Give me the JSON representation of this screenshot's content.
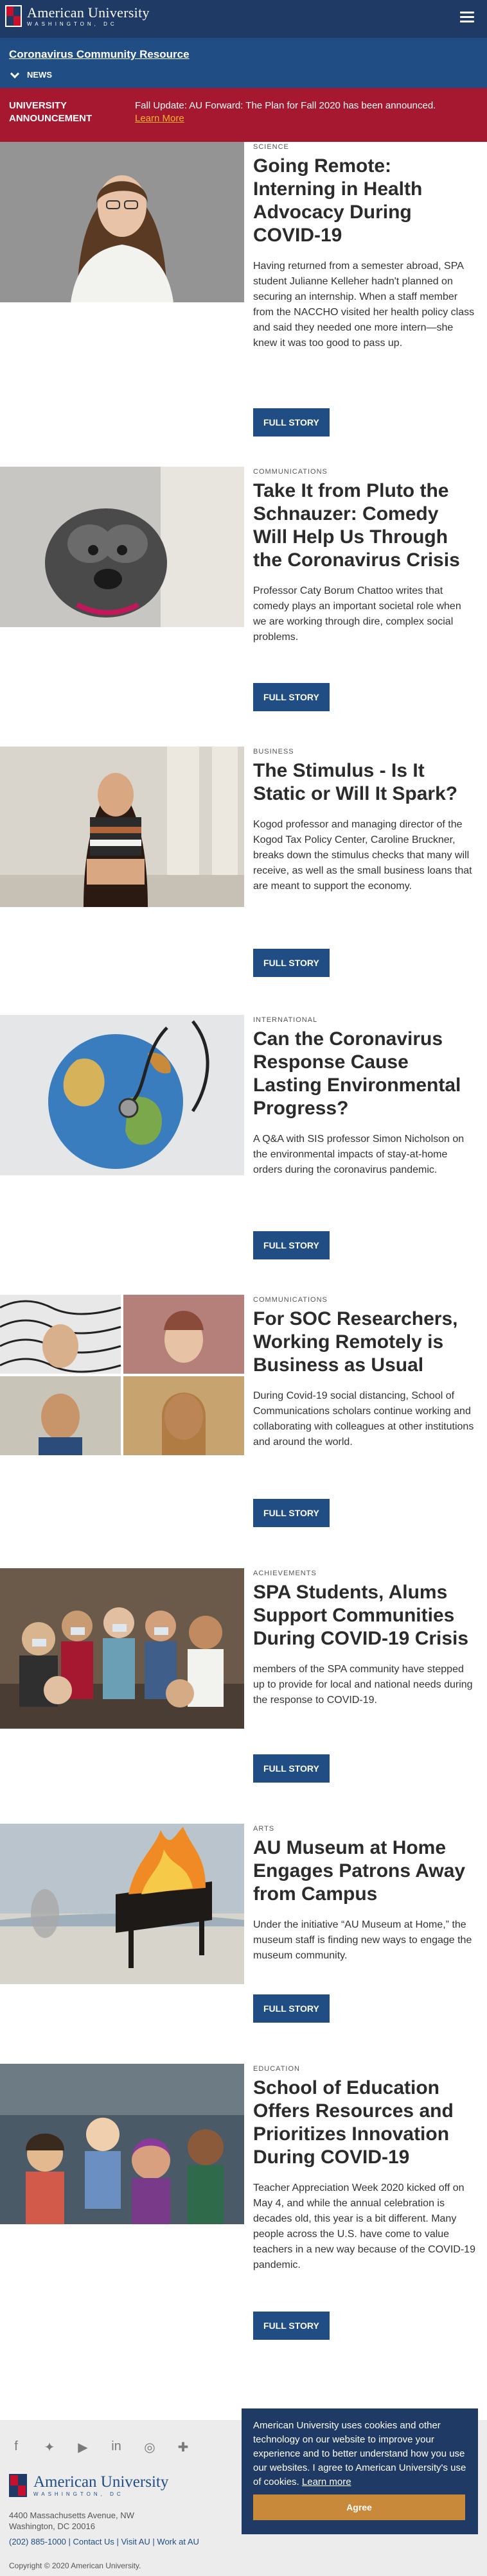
{
  "header": {
    "logo_name": "American University",
    "logo_city": "WASHINGTON, DC",
    "menu_icon": "hamburger-menu-icon"
  },
  "subnav": {
    "title": "Coronavirus Community Resource",
    "news_label": "NEWS"
  },
  "announcement": {
    "label": "University Announcement",
    "text": "Fall Update: AU Forward: The Plan for Fall 2020 has been announced.",
    "link": "Learn More"
  },
  "colors": {
    "header_navy": "#1f3a64",
    "subnav_blue": "#1f4d84",
    "announcement_red": "#a5182f",
    "link_gold": "#f7b32b",
    "button_blue": "#1f4d84",
    "cookie_button": "#c9893b"
  },
  "stories": [
    {
      "kicker": "SCIENCE",
      "headline": "Going Remote: Interning in Health Advocacy During COVID-19",
      "summary": "Having returned from a semester abroad, SPA student Julianne Kelleher hadn't planned on securing an internship. When a staff member from the NACCHO visited her health policy class and said they needed one more intern—she knew it was too good to pass up.",
      "button": "FULL STORY"
    },
    {
      "kicker": "COMMUNICATIONS",
      "headline": "Take It from Pluto the Schnauzer: Comedy Will Help Us Through the Coronavirus Crisis",
      "summary": "Professor Caty Borum Chattoo writes that comedy plays an important societal role when we are working through dire, complex social problems.",
      "button": "FULL STORY"
    },
    {
      "kicker": "BUSINESS",
      "headline": "The Stimulus - Is It Static or Will It Spark?",
      "summary": "Kogod professor and managing director of the Kogod Tax Policy Center, Caroline Bruckner, breaks down the stimulus checks that many will receive, as well as the small business loans that are meant to support the economy.",
      "button": "FULL STORY"
    },
    {
      "kicker": "INTERNATIONAL",
      "headline": "Can the Coronavirus Response Cause Lasting Environmental Progress?",
      "summary": "A Q&A with SIS professor Simon Nicholson on the environmental impacts of stay-at-home orders during the coronavirus pandemic.",
      "button": "FULL STORY"
    },
    {
      "kicker": "COMMUNICATIONS",
      "headline": "For SOC Researchers, Working Remotely is Business as Usual",
      "summary": "During Covid-19 social distancing, School of Communications scholars continue working and collaborating with colleagues at other institutions and around the world.",
      "button": "FULL STORY"
    },
    {
      "kicker": "ACHIEVEMENTS",
      "headline": "SPA Students, Alums Support Communities During COVID-19 Crisis",
      "summary": "members of the SPA community have stepped up to provide for local and national needs during the response to COVID-19.",
      "button": "FULL STORY"
    },
    {
      "kicker": "ARTS",
      "headline": "AU Museum at Home Engages Patrons Away from Campus",
      "summary": "Under the initiative “AU Museum at Home,” the museum staff is finding new ways to engage the museum community.",
      "button": "FULL STORY"
    },
    {
      "kicker": "EDUCATION",
      "headline": "School of Education Offers Resources and Prioritizes Innovation During COVID-19",
      "summary": "Teacher Appreciation Week 2020 kicked off on May 4, and while the annual celebration is decades old, this year is a bit different. Many people across the U.S. have come to value teachers in a new way because of the COVID-19 pandemic.",
      "button": "FULL STORY"
    }
  ],
  "footer": {
    "social_icons": [
      "facebook-icon",
      "twitter-icon",
      "youtube-icon",
      "linkedin-icon",
      "instagram-icon",
      "social-icon"
    ],
    "logo_name": "American University",
    "logo_city": "WASHINGTON, DC",
    "address_line1": "4400 Massachusetts Avenue, NW",
    "address_line2": "Washington, DC 20016",
    "phone": "(202) 885-1000",
    "contact": "Contact Us",
    "visit": "Visit AU",
    "work": "Work at AU",
    "separator": "|",
    "copyright": "Copyright © 2020 American University."
  },
  "cookie": {
    "text": "American University uses cookies and other technology on our website to improve your experience and to better understand how you use our websites. I agree to American University's use of cookies.",
    "link": "Learn more",
    "button": "Agree"
  }
}
